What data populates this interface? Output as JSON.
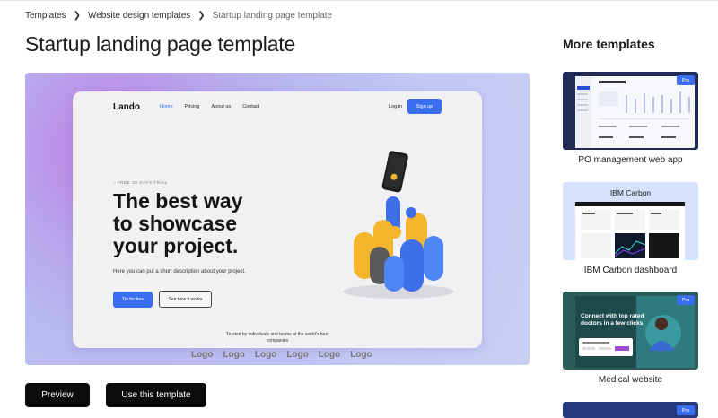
{
  "breadcrumb": {
    "items": [
      "Templates",
      "Website design templates"
    ],
    "current": "Startup landing page template"
  },
  "page": {
    "title": "Startup landing page template"
  },
  "preview_site": {
    "logo": "Lando",
    "nav": [
      "Home",
      "Pricing",
      "About us",
      "Contact"
    ],
    "login": "Log in",
    "signup": "Sign up",
    "trial": "– FREE 30 DAYS TRIAL",
    "headline": [
      "The best way",
      "to showcase",
      "your project."
    ],
    "description": "Here you can put a short description about your project.",
    "try_button": "Try for free",
    "how_button": "See how it works",
    "trusted": "Trusted by individuals and teams at the world's best companies",
    "logos": [
      "Logo",
      "Logo",
      "Logo",
      "Logo",
      "Logo",
      "Logo"
    ]
  },
  "actions": {
    "preview": "Preview",
    "use": "Use this template"
  },
  "sidebar": {
    "title": "More templates",
    "cards": [
      {
        "label": "PO management web app",
        "badge": "Pro"
      },
      {
        "label": "IBM Carbon dashboard",
        "header": "IBM Carbon"
      },
      {
        "label": "Medical website",
        "badge": "Pro",
        "hero": "Connect with top rated doctors in a few clicks"
      },
      {
        "badge": "Pro"
      }
    ]
  },
  "colors": {
    "accent": "#3a6df0",
    "button_dark": "#0b0b0b"
  }
}
